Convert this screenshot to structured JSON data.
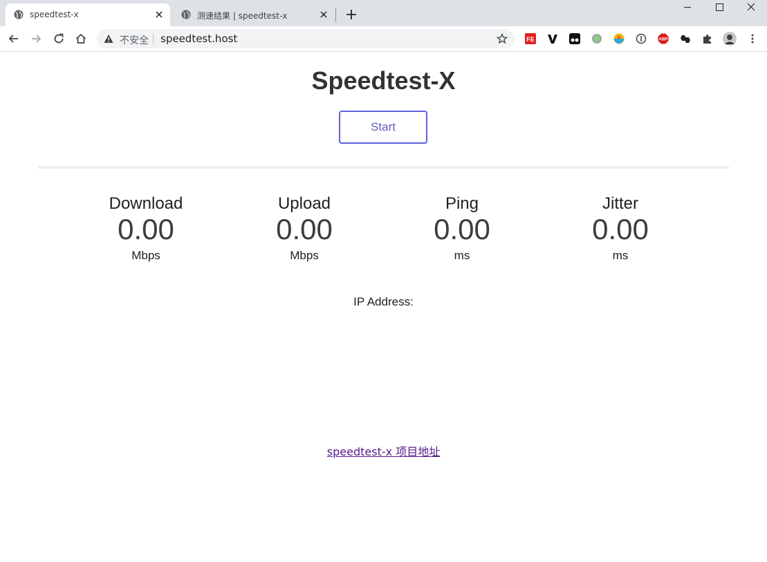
{
  "browser": {
    "tabs": [
      {
        "title": "speedtest-x",
        "active": true
      },
      {
        "title": "测速结果 | speedtest-x",
        "active": false
      }
    ],
    "address": {
      "security_label": "不安全",
      "url": "speedtest.host"
    },
    "extensions": [
      "fe-helper-icon",
      "v-icon",
      "tampermonkey-icon",
      "circle-icon",
      "ublock-icon",
      "info-icon",
      "adblock-plus-icon",
      "honey-icon",
      "puzzle-icon",
      "profile-avatar"
    ],
    "extension_labels": {
      "fe": "FE",
      "abp": "ABP"
    }
  },
  "page": {
    "title": "Speedtest-X",
    "start_label": "Start",
    "progress": 0,
    "metrics": [
      {
        "label": "Download",
        "value": "0.00",
        "unit": "Mbps"
      },
      {
        "label": "Upload",
        "value": "0.00",
        "unit": "Mbps"
      },
      {
        "label": "Ping",
        "value": "0.00",
        "unit": "ms"
      },
      {
        "label": "Jitter",
        "value": "0.00",
        "unit": "ms"
      }
    ],
    "ip_label": "IP Address:",
    "ip_value": "",
    "project_link": "speedtest-x 项目地址"
  },
  "colors": {
    "accent": "#6060e0",
    "tabstrip": "#dee1e6",
    "link_visited": "#551a8b"
  }
}
